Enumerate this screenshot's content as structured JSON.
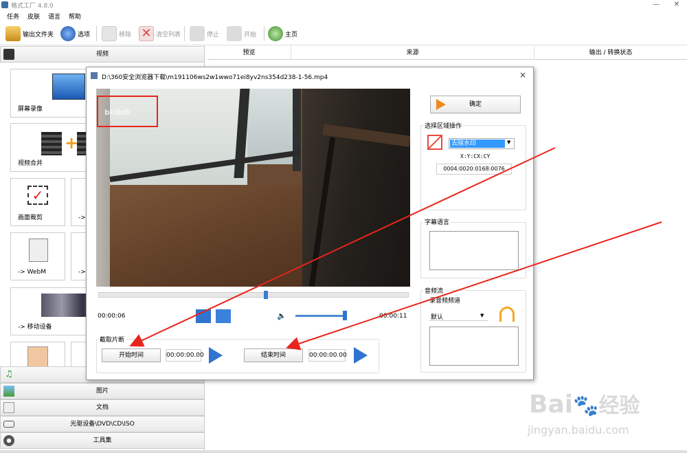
{
  "window": {
    "title": "格式工厂 4.8.0",
    "minimize": "—",
    "close": "✕"
  },
  "menu": [
    "任务",
    "皮肤",
    "语言",
    "帮助"
  ],
  "toolbar": {
    "output_folder": "输出文件夹",
    "options": "选项",
    "remove": "移除",
    "clear_list": "清空列表",
    "stop": "停止",
    "start": "开始",
    "home": "主页"
  },
  "sidebar": {
    "video_category": "视频",
    "tiles": [
      "屏幕录像",
      "视频合并",
      "画面裁剪",
      "-> WebM",
      "-> 移动设备"
    ],
    "partial_tile_labels": [
      "->",
      "->"
    ],
    "categories": [
      "图片",
      "文档",
      "光驱设备\\DVD\\CD\\ISO",
      "工具集"
    ]
  },
  "table": {
    "columns": [
      "预览",
      "来源",
      "输出 / 转换状态"
    ]
  },
  "dialog": {
    "title": "D:\\360安全浏览器下载\\m191106ws2w1wwo71ei8yv2ns354d238-1-56.mp4",
    "close": "×",
    "ok_button": "确定",
    "region": {
      "title": "选择区域操作",
      "mode": "去除水印",
      "coord_label": "X:Y:CX:CY",
      "coord_value": "0004:0020:0168:0076"
    },
    "subtitle": {
      "title": "字幕语言"
    },
    "audio": {
      "title": "音频流",
      "subtitle": "录音频频道",
      "select": "默认"
    },
    "player": {
      "current_time": "00:00:06",
      "total_time": "00:00:11",
      "seek_fraction": 0.54,
      "volume_fraction": 1.0
    },
    "clip": {
      "title": "截取片断",
      "start_button": "开始时间",
      "start_time": "00:00:00.00",
      "end_button": "结束时间",
      "end_time": "00:00:00.00"
    },
    "watermark_text": "bilibili"
  },
  "colors": {
    "annotation_red": "#e8241c",
    "play_blue": "#2f74d0",
    "slider_blue": "#4a8ad4"
  },
  "baidu": {
    "logo_prefix": "Bai",
    "logo_suffix": "经验",
    "url": "jingyan.baidu.com"
  }
}
